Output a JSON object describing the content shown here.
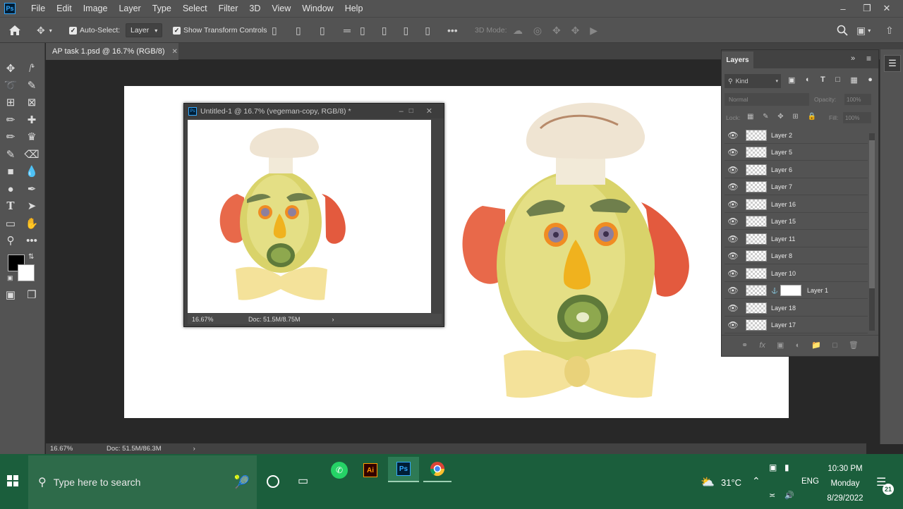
{
  "menubar": {
    "items": [
      "File",
      "Edit",
      "Image",
      "Layer",
      "Type",
      "Select",
      "Filter",
      "3D",
      "View",
      "Window",
      "Help"
    ],
    "logo": "Ps"
  },
  "options": {
    "auto_select_label": "Auto-Select:",
    "auto_select_value": "Layer",
    "show_transform_label": "Show Transform Controls",
    "mode_3d_label": "3D Mode:"
  },
  "document": {
    "tab_title": "AP task 1.psd @ 16.7% (RGB/8)",
    "zoom": "16.67%",
    "doc_info": "Doc: 51.5M/86.3M"
  },
  "float_window": {
    "title": "Untitled-1 @ 16.7% (vegeman-copy, RGB/8) *",
    "zoom": "16.67%",
    "doc_info": "Doc: 51.5M/8.75M"
  },
  "layers_panel": {
    "tab_label": "Layers",
    "filter_kind": "Kind",
    "blend_mode": "Normal",
    "opacity_label": "Opacity:",
    "opacity_value": "100%",
    "lock_label": "Lock:",
    "fill_label": "Fill:",
    "fill_value": "100%",
    "layers": [
      {
        "name": "Layer 2"
      },
      {
        "name": "Layer 5"
      },
      {
        "name": "Layer 6"
      },
      {
        "name": "Layer 7"
      },
      {
        "name": "Layer 16"
      },
      {
        "name": "Layer 15"
      },
      {
        "name": "Layer 11"
      },
      {
        "name": "Layer 8"
      },
      {
        "name": "Layer 10"
      },
      {
        "name": "Layer 1"
      },
      {
        "name": "Layer 18"
      },
      {
        "name": "Layer 17"
      }
    ]
  },
  "taskbar": {
    "search_placeholder": "Type here to search",
    "weather_temp": "31°C",
    "language": "ENG",
    "time": "10:30 PM",
    "day": "Monday",
    "date": "8/29/2022",
    "notification_count": "21",
    "apps": [
      "whatsapp-icon",
      "illustrator-icon",
      "photoshop-icon",
      "chrome-icon"
    ],
    "illustrator_label": "Ai",
    "photoshop_label": "Ps"
  },
  "colors": {
    "ui_panel": "#535353",
    "ui_dark": "#282828",
    "taskbar": "#1b5e3c",
    "ps_blue": "#31a8ff"
  }
}
